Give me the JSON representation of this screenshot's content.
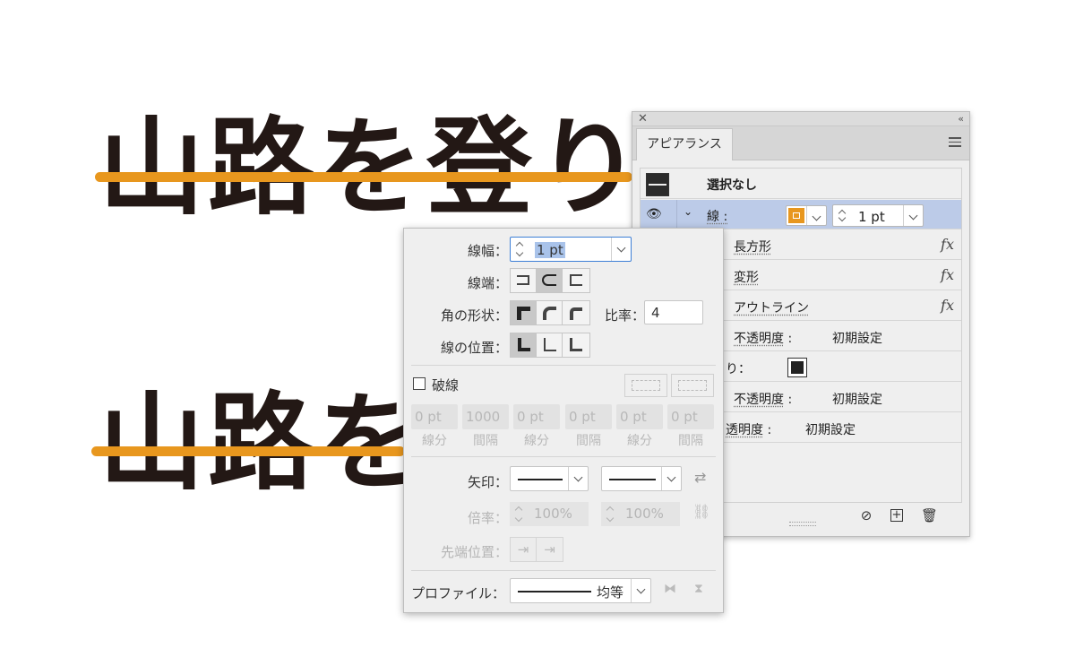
{
  "artwork": {
    "line1": "山路を登りな",
    "line2": "山路を",
    "stroke_color": "#e8971e"
  },
  "appearance_panel": {
    "tab": "アピアランス",
    "header": "選択なし",
    "stroke_row": {
      "label": "線",
      "width_value": "1 pt"
    },
    "effects": [
      "長方形",
      "変形",
      "アウトライン"
    ],
    "fx_label": "fx",
    "opacity_label": "不透明度",
    "opacity_value": "初期設定",
    "fill_label_fragment": "り：",
    "opacity_label_partial": "透明度",
    "colon": ":"
  },
  "stroke_popup": {
    "width_label": "線幅：",
    "width_value": "1 pt",
    "cap_label": "線端：",
    "corner_label": "角の形状：",
    "ratio_label": "比率：",
    "ratio_value": "4",
    "align_label": "線の位置：",
    "dashed_label": "破線",
    "dash_values": [
      "0 pt",
      "1000",
      "0 pt",
      "0 pt",
      "0 pt",
      "0 pt"
    ],
    "dash_labels": [
      "線分",
      "間隔",
      "線分",
      "間隔",
      "線分",
      "間隔"
    ],
    "arrow_label": "矢印：",
    "scale_label": "倍率：",
    "scale_value_1": "100%",
    "scale_value_2": "100%",
    "tip_label": "先端位置：",
    "profile_label": "プロファイル：",
    "profile_value": "均等"
  }
}
